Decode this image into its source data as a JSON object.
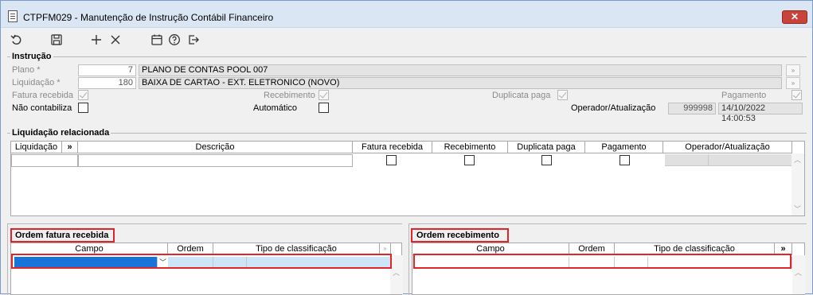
{
  "window": {
    "title": "CTPFM029 - Manutenção de Instrução Contábil Financeiro",
    "close_label": "✕"
  },
  "toolbar": {
    "icons": [
      "undo-icon",
      "save-icon",
      "add-icon",
      "delete-icon",
      "calendar-icon",
      "help-icon",
      "exit-icon"
    ]
  },
  "instrucao": {
    "title": "Instrução",
    "plano_label": "Plano *",
    "plano_value": "7",
    "plano_desc": "PLANO DE CONTAS POOL 007",
    "liquidacao_label": "Liquidação *",
    "liquidacao_value": "180",
    "liquidacao_desc": "BAIXA DE CARTAO - EXT. ELETRONICO (NOVO)",
    "fatura_recebida_label": "Fatura recebida",
    "recebimento_label": "Recebimento",
    "duplicata_paga_label": "Duplicata paga",
    "pagamento_label": "Pagamento",
    "nao_contabiliza_label": "Não contabiliza",
    "automatico_label": "Automático",
    "operador_label": "Operador/Atualização",
    "operador_value": "999998",
    "atualizacao_value": "14/10/2022 14:00:53"
  },
  "liquidacao_relacionada": {
    "title": "Liquidação relacionada",
    "columns": [
      "Liquidação",
      "»",
      "Descrição",
      "Fatura recebida",
      "Recebimento",
      "Duplicata paga",
      "Pagamento",
      "Operador/Atualização"
    ]
  },
  "ordem_fatura": {
    "title": "Ordem fatura recebida",
    "columns": [
      "Campo",
      "Ordem",
      "Tipo de classificação"
    ]
  },
  "ordem_recebimento": {
    "title": "Ordem recebimento",
    "columns": [
      "Campo",
      "Ordem",
      "Tipo de classificação",
      "»"
    ]
  },
  "colors": {
    "selection": "#1874d8",
    "highlight": "#e2232a",
    "close": "#c8443a"
  }
}
